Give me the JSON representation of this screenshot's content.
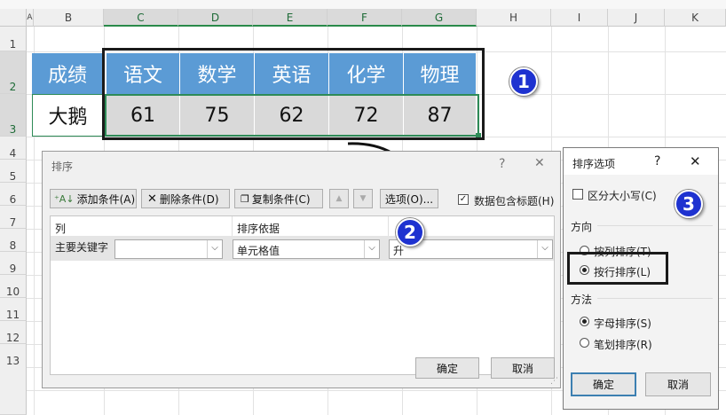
{
  "spreadsheet": {
    "columns": [
      "A",
      "B",
      "C",
      "D",
      "E",
      "F",
      "G",
      "H",
      "I",
      "J",
      "K"
    ],
    "rows": [
      "1",
      "2",
      "3",
      "4",
      "5",
      "6",
      "7",
      "8",
      "9",
      "10",
      "11",
      "12",
      "13"
    ],
    "table": {
      "header": [
        "成绩",
        "语文",
        "数学",
        "英语",
        "化学",
        "物理"
      ],
      "data": [
        "大鹅",
        "61",
        "75",
        "62",
        "72",
        "87"
      ]
    }
  },
  "badges": {
    "b1": "1",
    "b2": "2",
    "b3": "3"
  },
  "sort_dialog": {
    "title": "排序",
    "help": "?",
    "close": "✕",
    "toolbar": {
      "add_level": "添加条件(A)",
      "delete_level": "删除条件(D)",
      "copy_level": "复制条件(C)",
      "move_up": "▲",
      "move_down": "▼",
      "options": "选项(O)...",
      "has_headers": "数据包含标题(H)"
    },
    "headers": {
      "column": "列",
      "sort_on": "排序依据",
      "order": ""
    },
    "row": {
      "label": "主要关键字",
      "column_value": "",
      "sort_on_value": "单元格值",
      "order_value": "升"
    },
    "ok": "确定",
    "cancel": "取消"
  },
  "options_dialog": {
    "title": "排序选项",
    "help": "?",
    "close": "✕",
    "case_sensitive": "区分大小写(C)",
    "orientation_label": "方向",
    "sort_top_to_bottom": "按列排序(T)",
    "sort_left_to_right": "按行排序(L)",
    "method_label": "方法",
    "letter_sort": "字母排序(S)",
    "stroke_sort": "笔划排序(R)",
    "ok": "确定",
    "cancel": "取消"
  },
  "colors": {
    "header_blue": "#5b9bd5",
    "badge_blue": "#1e32d0",
    "excel_green": "#217346"
  }
}
